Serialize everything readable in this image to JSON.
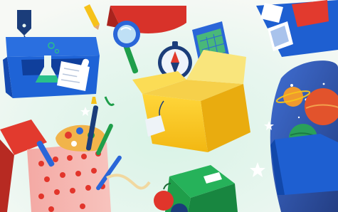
{
  "illustration": {
    "subject": "floating-boxes-of-hobbies-and-science",
    "items": [
      {
        "name": "blue-box-with-flask-and-papers",
        "color": "#1e63d6"
      },
      {
        "name": "yellow-box-with-compass-and-map",
        "color": "#f6c21a"
      },
      {
        "name": "red-pot-with-brushes-and-palette",
        "color": "#e23a2e"
      },
      {
        "name": "green-box",
        "color": "#1f9e4a"
      },
      {
        "name": "blue-box-with-planets",
        "color": "#1e5fd1"
      },
      {
        "name": "red-box-top-center",
        "color": "#d8322a"
      },
      {
        "name": "magnifying-glass-icon",
        "color": "#2a66d8"
      },
      {
        "name": "paintbrush-icon",
        "color": "#2a66d8"
      },
      {
        "name": "apple-icon",
        "color": "#e0352b"
      },
      {
        "name": "tag-icon",
        "color": "#1b3d7a"
      }
    ],
    "background_colors": {
      "light": "#f4f7f1",
      "mint": "#cfeede",
      "space": "#0e2c7a"
    }
  }
}
